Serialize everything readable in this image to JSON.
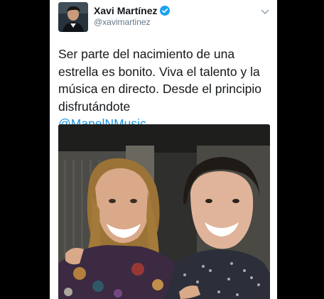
{
  "tweet": {
    "author": {
      "display_name": "Xavi Martínez",
      "handle": "@xavimartinez",
      "verified": true
    },
    "text_main": "Ser parte del nacimiento de una estrella es bonito. Viva el talento y la música en directo. Desde el principio disfrutándote",
    "mention": "@ManelNMusic",
    "icons": {
      "verified": "verified-badge-icon",
      "menu": "chevron-down-icon"
    },
    "colors": {
      "verified_blue": "#1da1f2",
      "mention_blue": "#1b95e0",
      "text": "#14171a",
      "secondary_text": "#657786",
      "background": "#000000"
    }
  }
}
